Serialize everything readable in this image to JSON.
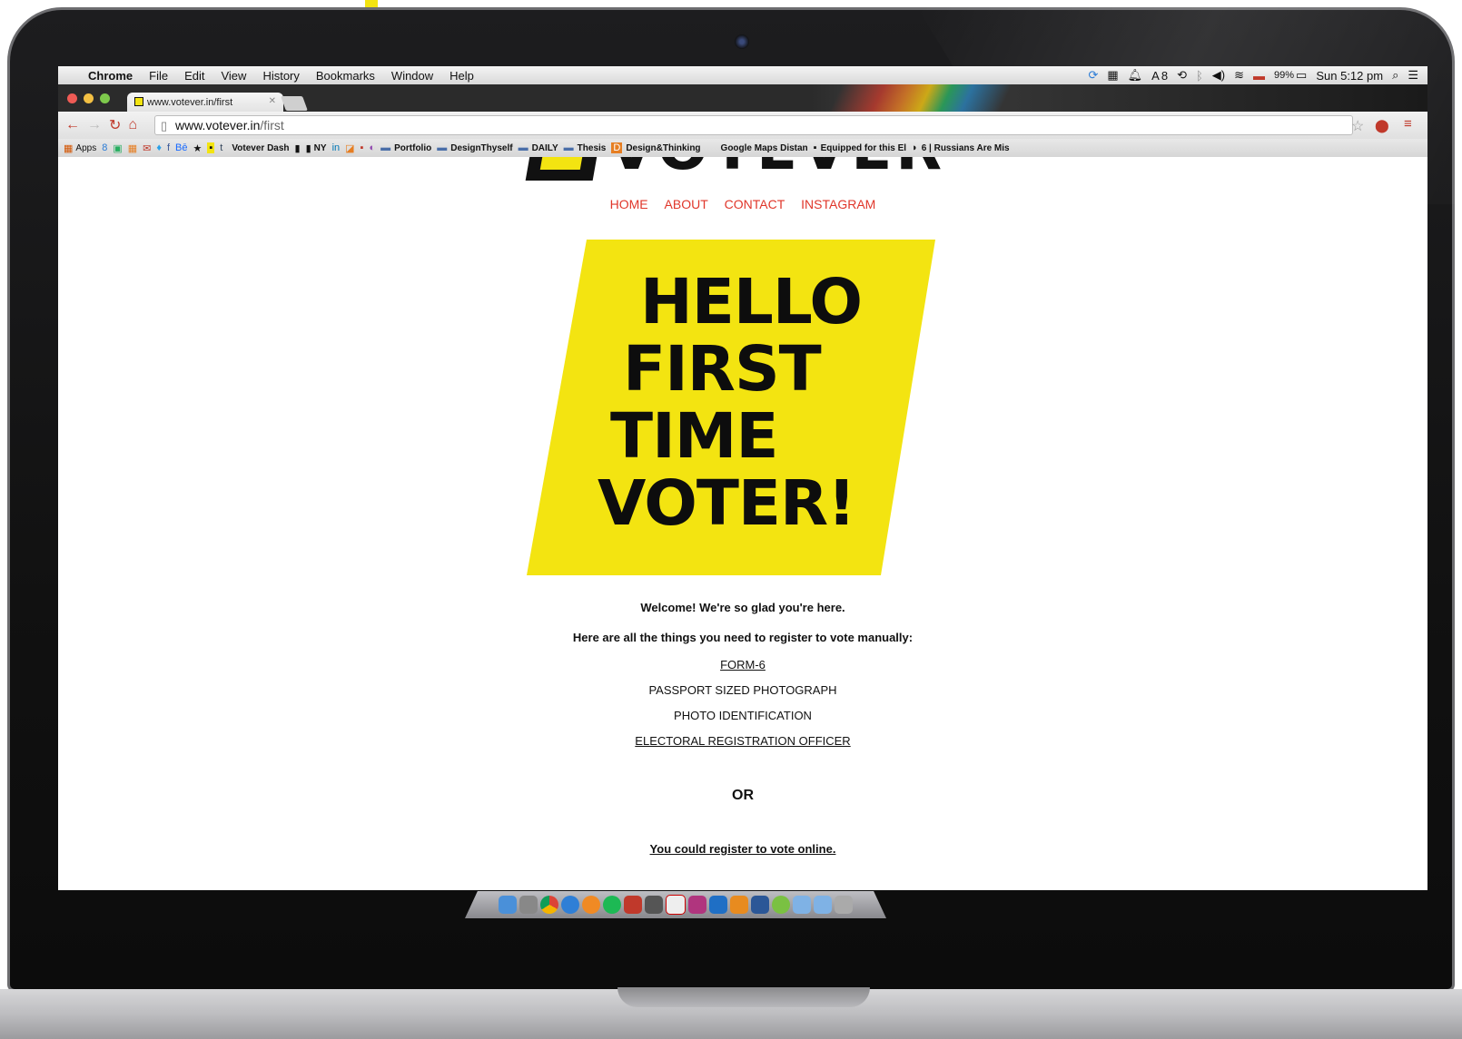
{
  "menubar": {
    "app": "Chrome",
    "items": [
      "File",
      "Edit",
      "View",
      "History",
      "Bookmarks",
      "Window",
      "Help"
    ],
    "status": {
      "battery": "99%",
      "clock": "Sun 5:12 pm",
      "count": "8"
    }
  },
  "tab": {
    "title": "www.votever.in/first"
  },
  "omnibox": {
    "host": "www.votever.in",
    "path": "/first"
  },
  "bookmarks": [
    "Apps",
    "Votever Dash",
    "NY",
    "Portfolio",
    "DesignThyself",
    "DAILY",
    "Thesis",
    "Design&Thinking",
    "Google Maps Distan",
    "Equipped for this El",
    "6 | Russians Are Mis"
  ],
  "site": {
    "logo_word": "VOTEVER",
    "nav": [
      "HOME",
      "ABOUT",
      "CONTACT",
      "INSTAGRAM"
    ],
    "poster_lines": [
      "HELLO",
      "FIRST",
      "TIME",
      "VOTER!"
    ],
    "poster_color": "#f3e411",
    "welcome": "Welcome! We're so glad you're here.",
    "intro": "Here are all the things you need to register to vote manually:",
    "requirements": [
      "FORM-6",
      "PASSPORT SIZED PHOTOGRAPH",
      "PHOTO IDENTIFICATION",
      "ELECTORAL REGISTRATION OFFICER"
    ],
    "or": "OR",
    "online_link": "You could register to vote online."
  },
  "colors": {
    "nav": "#e0362a",
    "accent_yellow": "#f3e411"
  }
}
